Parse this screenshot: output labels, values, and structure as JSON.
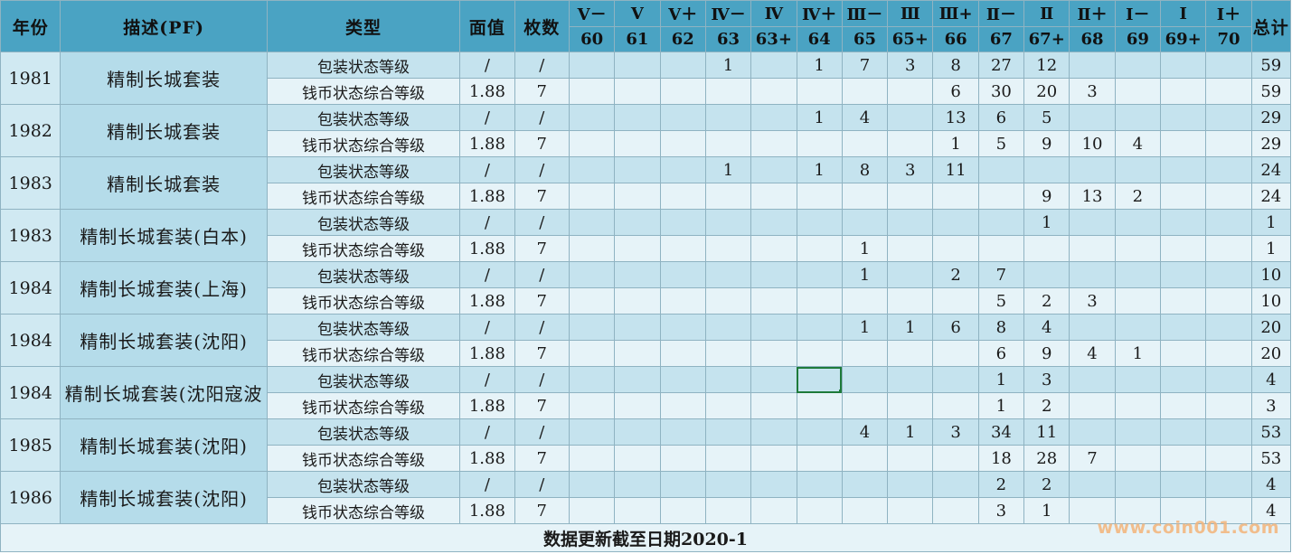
{
  "headers": {
    "year": "年份",
    "desc": "描述(PF)",
    "type": "类型",
    "face": "面值",
    "count": "枚数",
    "total": "总计",
    "grades": [
      [
        "V－",
        "60"
      ],
      [
        "V",
        "61"
      ],
      [
        "V＋",
        "62"
      ],
      [
        "Ⅳ－",
        "63"
      ],
      [
        "Ⅳ",
        "63+"
      ],
      [
        "Ⅳ＋",
        "64"
      ],
      [
        "Ⅲ－",
        "65"
      ],
      [
        "Ⅲ",
        "65+"
      ],
      [
        "Ⅲ+",
        "66"
      ],
      [
        "Ⅱ－",
        "67"
      ],
      [
        "Ⅱ",
        "67+"
      ],
      [
        "Ⅱ＋",
        "68"
      ],
      [
        "Ⅰ－",
        "69"
      ],
      [
        "Ⅰ",
        "69+"
      ],
      [
        "Ⅰ＋",
        "70"
      ]
    ]
  },
  "groups": [
    {
      "year": "1981",
      "desc": "精制长城套装",
      "rows": [
        {
          "type": "包装状态等级",
          "face": "/",
          "count": "/",
          "grades": [
            "",
            "",
            "",
            "1",
            "",
            "1",
            "7",
            "3",
            "8",
            "27",
            "12",
            "",
            "",
            "",
            ""
          ],
          "total": "59"
        },
        {
          "type": "钱币状态综合等级",
          "face": "1.88",
          "count": "7",
          "grades": [
            "",
            "",
            "",
            "",
            "",
            "",
            "",
            "",
            "6",
            "30",
            "20",
            "3",
            "",
            "",
            ""
          ],
          "total": "59"
        }
      ]
    },
    {
      "year": "1982",
      "desc": "精制长城套装",
      "rows": [
        {
          "type": "包装状态等级",
          "face": "/",
          "count": "/",
          "grades": [
            "",
            "",
            "",
            "",
            "",
            "1",
            "4",
            "",
            "13",
            "6",
            "5",
            "",
            "",
            "",
            ""
          ],
          "total": "29"
        },
        {
          "type": "钱币状态综合等级",
          "face": "1.88",
          "count": "7",
          "grades": [
            "",
            "",
            "",
            "",
            "",
            "",
            "",
            "",
            "1",
            "5",
            "9",
            "10",
            "4",
            "",
            ""
          ],
          "total": "29"
        }
      ]
    },
    {
      "year": "1983",
      "desc": "精制长城套装",
      "rows": [
        {
          "type": "包装状态等级",
          "face": "/",
          "count": "/",
          "grades": [
            "",
            "",
            "",
            "1",
            "",
            "1",
            "8",
            "3",
            "11",
            "",
            "",
            "",
            "",
            "",
            ""
          ],
          "total": "24"
        },
        {
          "type": "钱币状态综合等级",
          "face": "1.88",
          "count": "7",
          "grades": [
            "",
            "",
            "",
            "",
            "",
            "",
            "",
            "",
            "",
            "",
            "9",
            "13",
            "2",
            "",
            ""
          ],
          "total": "24"
        }
      ]
    },
    {
      "year": "1983",
      "desc": "精制长城套装(白本)",
      "rows": [
        {
          "type": "包装状态等级",
          "face": "/",
          "count": "/",
          "grades": [
            "",
            "",
            "",
            "",
            "",
            "",
            "",
            "",
            "",
            "",
            "1",
            "",
            "",
            "",
            ""
          ],
          "total": "1"
        },
        {
          "type": "钱币状态综合等级",
          "face": "1.88",
          "count": "7",
          "grades": [
            "",
            "",
            "",
            "",
            "",
            "",
            "1",
            "",
            "",
            "",
            "",
            "",
            "",
            "",
            ""
          ],
          "total": "1"
        }
      ]
    },
    {
      "year": "1984",
      "desc": "精制长城套装(上海)",
      "rows": [
        {
          "type": "包装状态等级",
          "face": "/",
          "count": "/",
          "grades": [
            "",
            "",
            "",
            "",
            "",
            "",
            "1",
            "",
            "2",
            "7",
            "",
            "",
            "",
            "",
            ""
          ],
          "total": "10"
        },
        {
          "type": "钱币状态综合等级",
          "face": "1.88",
          "count": "7",
          "grades": [
            "",
            "",
            "",
            "",
            "",
            "",
            "",
            "",
            "",
            "5",
            "2",
            "3",
            "",
            "",
            ""
          ],
          "total": "10"
        }
      ]
    },
    {
      "year": "1984",
      "desc": "精制长城套装(沈阳)",
      "rows": [
        {
          "type": "包装状态等级",
          "face": "/",
          "count": "/",
          "grades": [
            "",
            "",
            "",
            "",
            "",
            "",
            "1",
            "1",
            "6",
            "8",
            "4",
            "",
            "",
            "",
            ""
          ],
          "total": "20"
        },
        {
          "type": "钱币状态综合等级",
          "face": "1.88",
          "count": "7",
          "grades": [
            "",
            "",
            "",
            "",
            "",
            "",
            "",
            "",
            "",
            "6",
            "9",
            "4",
            "1",
            "",
            ""
          ],
          "total": "20"
        }
      ]
    },
    {
      "year": "1984",
      "desc": "精制长城套装(沈阳寇波",
      "rows": [
        {
          "type": "包装状态等级",
          "face": "/",
          "count": "/",
          "grades": [
            "",
            "",
            "",
            "",
            "",
            "",
            "",
            "",
            "",
            "1",
            "3",
            "",
            "",
            "",
            ""
          ],
          "total": "4"
        },
        {
          "type": "钱币状态综合等级",
          "face": "1.88",
          "count": "7",
          "grades": [
            "",
            "",
            "",
            "",
            "",
            "",
            "",
            "",
            "",
            "1",
            "2",
            "",
            "",
            "",
            ""
          ],
          "total": "3"
        }
      ]
    },
    {
      "year": "1985",
      "desc": "精制长城套装(沈阳)",
      "rows": [
        {
          "type": "包装状态等级",
          "face": "/",
          "count": "/",
          "grades": [
            "",
            "",
            "",
            "",
            "",
            "",
            "4",
            "1",
            "3",
            "34",
            "11",
            "",
            "",
            "",
            ""
          ],
          "total": "53"
        },
        {
          "type": "钱币状态综合等级",
          "face": "1.88",
          "count": "7",
          "grades": [
            "",
            "",
            "",
            "",
            "",
            "",
            "",
            "",
            "",
            "18",
            "28",
            "7",
            "",
            "",
            ""
          ],
          "total": "53"
        }
      ]
    },
    {
      "year": "1986",
      "desc": "精制长城套装(沈阳)",
      "rows": [
        {
          "type": "包装状态等级",
          "face": "/",
          "count": "/",
          "grades": [
            "",
            "",
            "",
            "",
            "",
            "",
            "",
            "",
            "",
            "2",
            "2",
            "",
            "",
            "",
            ""
          ],
          "total": "4"
        },
        {
          "type": "钱币状态综合等级",
          "face": "1.88",
          "count": "7",
          "grades": [
            "",
            "",
            "",
            "",
            "",
            "",
            "",
            "",
            "",
            "3",
            "1",
            "",
            "",
            "",
            ""
          ],
          "total": "4"
        }
      ]
    }
  ],
  "footer": "数据更新截至日期2020-1",
  "watermark": "www.coin001.com",
  "colors": {
    "header": "#4aa3c3",
    "desc": "#b5dcea",
    "row_dark": "#c5e3ee",
    "row_light": "#e6f3f8",
    "selection": "#1e7a3a"
  }
}
